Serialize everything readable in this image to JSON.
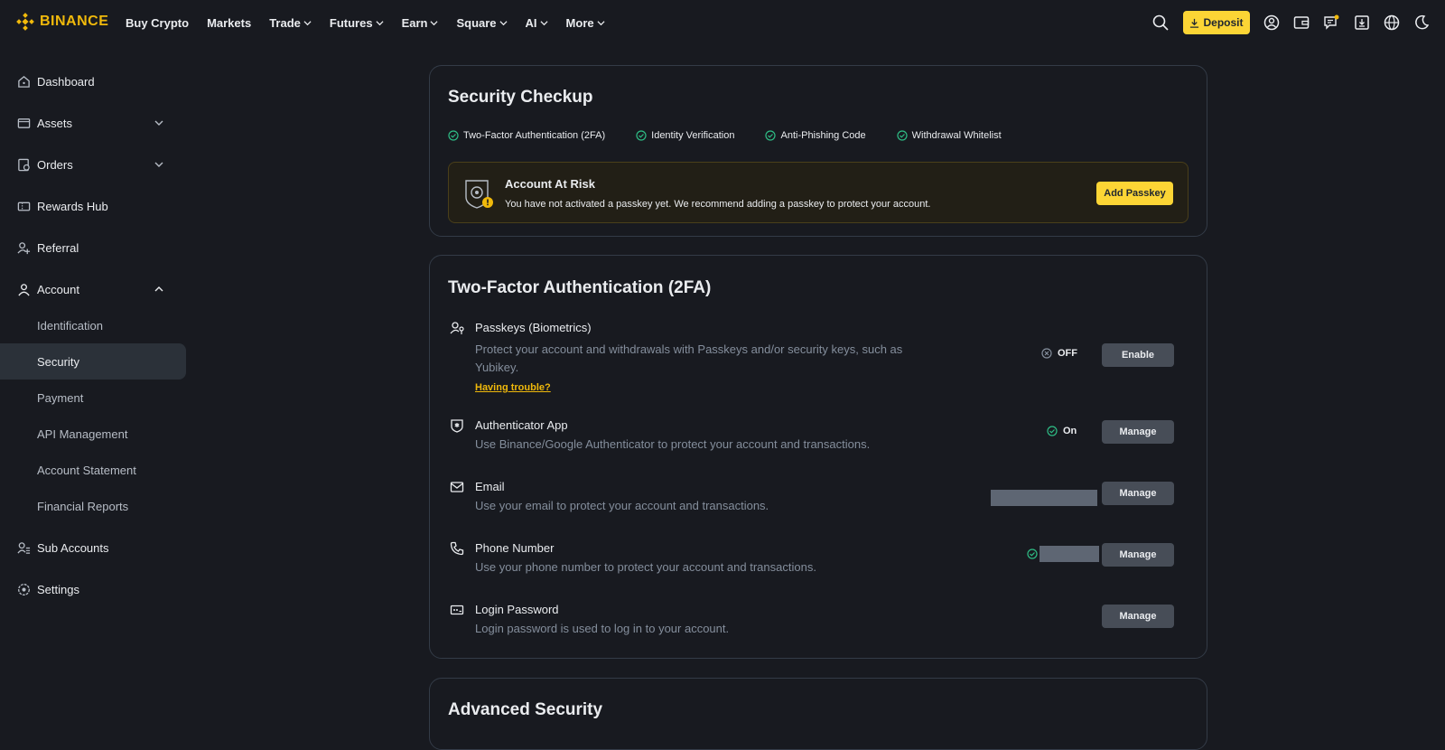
{
  "brand": {
    "name": "BINANCE",
    "color": "#f0b90b"
  },
  "nav": {
    "items": [
      {
        "label": "Buy Crypto",
        "dropdown": false
      },
      {
        "label": "Markets",
        "dropdown": false
      },
      {
        "label": "Trade",
        "dropdown": true
      },
      {
        "label": "Futures",
        "dropdown": true
      },
      {
        "label": "Earn",
        "dropdown": true
      },
      {
        "label": "Square",
        "dropdown": true
      },
      {
        "label": "AI",
        "dropdown": true
      },
      {
        "label": "More",
        "dropdown": true
      }
    ],
    "deposit_label": "Deposit",
    "icons": [
      "search-icon",
      "user-icon",
      "wallet-icon",
      "notification-icon",
      "download-icon",
      "globe-icon",
      "dark-mode-icon"
    ]
  },
  "sidebar": {
    "items": [
      {
        "label": "Dashboard",
        "icon": "home-icon"
      },
      {
        "label": "Assets",
        "icon": "wallet-icon"
      },
      {
        "label": "Orders",
        "icon": "orders-icon"
      },
      {
        "label": "Rewards Hub",
        "icon": "ticket-icon"
      },
      {
        "label": "Referral",
        "icon": "referral-icon"
      },
      {
        "label": "Account",
        "icon": "user-icon"
      },
      {
        "label": "Identification"
      },
      {
        "label": "Security"
      },
      {
        "label": "Payment"
      },
      {
        "label": "API Management"
      },
      {
        "label": "Account Statement"
      },
      {
        "label": "Financial Reports"
      },
      {
        "label": "Sub Accounts",
        "icon": "sub-accounts-icon"
      },
      {
        "label": "Settings",
        "icon": "settings-icon"
      }
    ],
    "active": "Security"
  },
  "checkup": {
    "title": "Security Checkup",
    "checks": [
      "Two-Factor Authentication (2FA)",
      "Identity Verification",
      "Anti-Phishing Code",
      "Withdrawal Whitelist"
    ],
    "risk": {
      "title": "Account At Risk",
      "description": "You have not activated a passkey yet. We recommend adding a passkey to protect your account.",
      "button": "Add Passkey"
    }
  },
  "twofa": {
    "title": "Two-Factor Authentication (2FA)",
    "rows": [
      {
        "title": "Passkeys (Biometrics)",
        "desc_line1": "Protect your account and withdrawals with Passkeys and/or security keys, such as",
        "desc_line2": "Yubikey.",
        "link": "Having trouble?",
        "status": "OFF",
        "button": "Enable"
      },
      {
        "title": "Authenticator App",
        "desc_line1": "Use Binance/Google Authenticator to protect your account and transactions.",
        "status": "On",
        "button": "Manage"
      },
      {
        "title": "Email",
        "desc_line1": "Use your email to protect your account and transactions.",
        "button": "Manage"
      },
      {
        "title": "Phone Number",
        "desc_line1": "Use your phone number to protect your account and transactions.",
        "button": "Manage"
      },
      {
        "title": "Login Password",
        "desc_line1": "Login password is used to log in to your account.",
        "button": "Manage"
      }
    ]
  },
  "advanced": {
    "title": "Advanced Security"
  },
  "colors": {
    "background": "#181a20",
    "accent": "#fcd535",
    "success": "#2ebd85",
    "muted": "#848e9c",
    "button": "#474d57"
  }
}
